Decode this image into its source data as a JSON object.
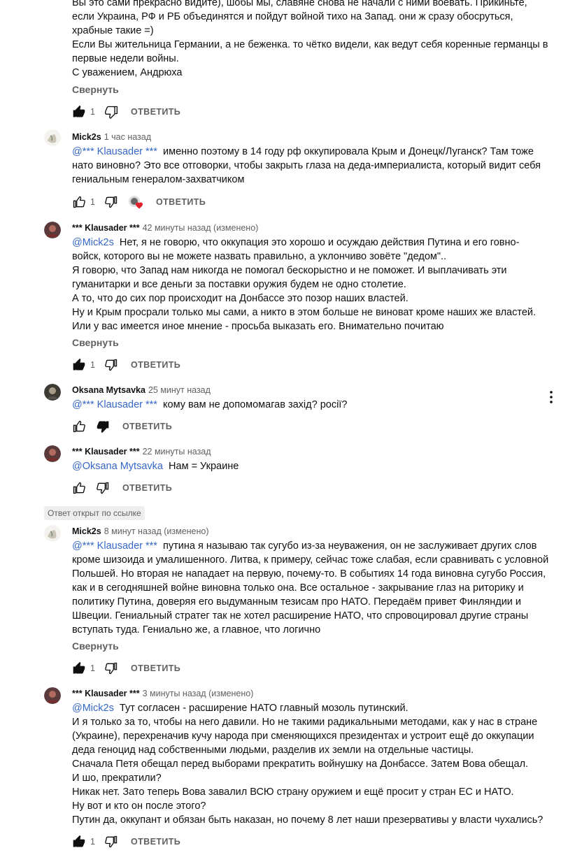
{
  "top": {
    "lines": [
      "Вы это сами прекрасно видите), шобы мы, славяне снова не начали с ними воевать. Прикиньте,",
      "если Украина, РФ и РБ объединятся и пойдут войной тихо на Запад. они ж сразу обосруться,",
      "храбные такие =)",
      "Если Вы жительница Германии, а не беженка. то чётко видели, как ведут себя коренные германцы в",
      "первые недели войны.",
      "С уважением, Андрюха"
    ],
    "collapse": "Свернуть",
    "likes": "1",
    "reply": "ОТВЕТИТЬ"
  },
  "comments": [
    {
      "author": "Mick2s",
      "time": "1 час назад",
      "mention": "@*** Klausader ***",
      "lines": [
        "именно поэтому в 14 году рф оккупировала Крым и Донецк/Луганск? Там тоже",
        "нато виновно? Это все отговорки, чтобы закрыть глаза на деда-империалиста, который видит себя",
        "гениальным генералом-захватчиком"
      ],
      "likes": "1",
      "reply": "ОТВЕТИТЬ",
      "hearted": true
    },
    {
      "author": "*** Klausader ***",
      "time": "42 минуты назад (изменено)",
      "mention": "@Mick2s",
      "lines": [
        "Нет, я не говорю, что оккупация это хорошо и осуждаю действия Путина и его говно-",
        "войск, которого вы не можете назвать правильно, а уклончиво зовёте \"дедом\"..",
        "Я говорю, что Запад нам никогда не помогал бескорыстно и не поможет. И выплачивать эти",
        "гуманитарки и все деньги за поставки оружия будем не одно столетие.",
        "А то, что до сих пор происходит на Донбассе это позор наших властей.",
        "Ну и Крым просрали только мы сами, а никто в этом больше не виноват кроме наших же властей.",
        "Или у вас имеется иное мнение - просьба выказать его. Внимательно почитаю"
      ],
      "collapse": "Свернуть",
      "likes": "1",
      "reply": "ОТВЕТИТЬ"
    },
    {
      "author": "Oksana Mytsavka",
      "time": "25 минут назад",
      "mention": "@*** Klausader ***",
      "lines": [
        "кому вам не допомомагав захід? росії?"
      ],
      "likes": "",
      "reply": "ОТВЕТИТЬ"
    },
    {
      "author": "*** Klausader ***",
      "time": "22 минуты назад",
      "mention": "@Oksana Mytsavka",
      "lines": [
        "Нам = Украине"
      ],
      "likes": "",
      "reply": "ОТВЕТИТЬ"
    },
    {
      "badge": "Ответ открыт по ссылке",
      "author": "Mick2s",
      "time": "8 минут назад (изменено)",
      "mention": "@*** Klausader ***",
      "lines": [
        "путина я называю так сугубо из-за неуважения, он не заслуживает других слов",
        "кроме шизоида и умалишенного. Литва, к примеру, сейчас тоже слабая, если сравнивать с условной",
        "Польшей. Но вторая не нападает на первую, почему-то. В событиях 14 года виновна сугубо Россия,",
        "как и в сегодняшней войне виновна только она. Все остальное - закрывание глаз на риторику и",
        "политику Путина, доверяя его выдуманным тезисам про НАТО. Передаём привет Финляндии и",
        "Швеции. Гениальный стратег так не хотел расширение НАТО, что спровоцировал другие страны",
        "вступать туда. Гениально же, а главное, что логично"
      ],
      "collapse": "Свернуть",
      "likes": "1",
      "reply": "ОТВЕТИТЬ"
    },
    {
      "author": "*** Klausader ***",
      "time": "3 минуты назад (изменено)",
      "mention": "@Mick2s",
      "lines": [
        "Тут согласен - расширение НАТО главный мозоль путинский.",
        "И я только за то, чтобы на него давили. Но не такими радикальными методами, как у нас в стране",
        "(Украине), перехреначив кучу народа при сменяющихся президентах и устроит ещё до оккупации",
        "деда геноцид над собственными людьми, разделив их земли на отдельные частицы.",
        "Сначала Петя обещал перед выборами прекратить войнушку на Донбассе. Затем Вова обещал.",
        "И шо, прекратили?",
        "Никак нет. Зато теперь Вова завалил ВСЮ страну оружием и ещё просит у стран ЕС и НАТО.",
        "Ну вот и кто он после этого?",
        "Путин да, оккупант и обязан быть наказан, но почему 8 лет наши презервативы у власти чухались?"
      ],
      "likes": "1",
      "reply": "ОТВЕТИТЬ"
    }
  ],
  "icons": {
    "like": "thumbs-up-icon",
    "dislike": "thumbs-down-icon",
    "more": "more-vertical-icon",
    "heart": "creator-heart-icon"
  },
  "colors": {
    "mention": "#3567c6",
    "heart": "#e0202a",
    "muted": "#606060"
  }
}
